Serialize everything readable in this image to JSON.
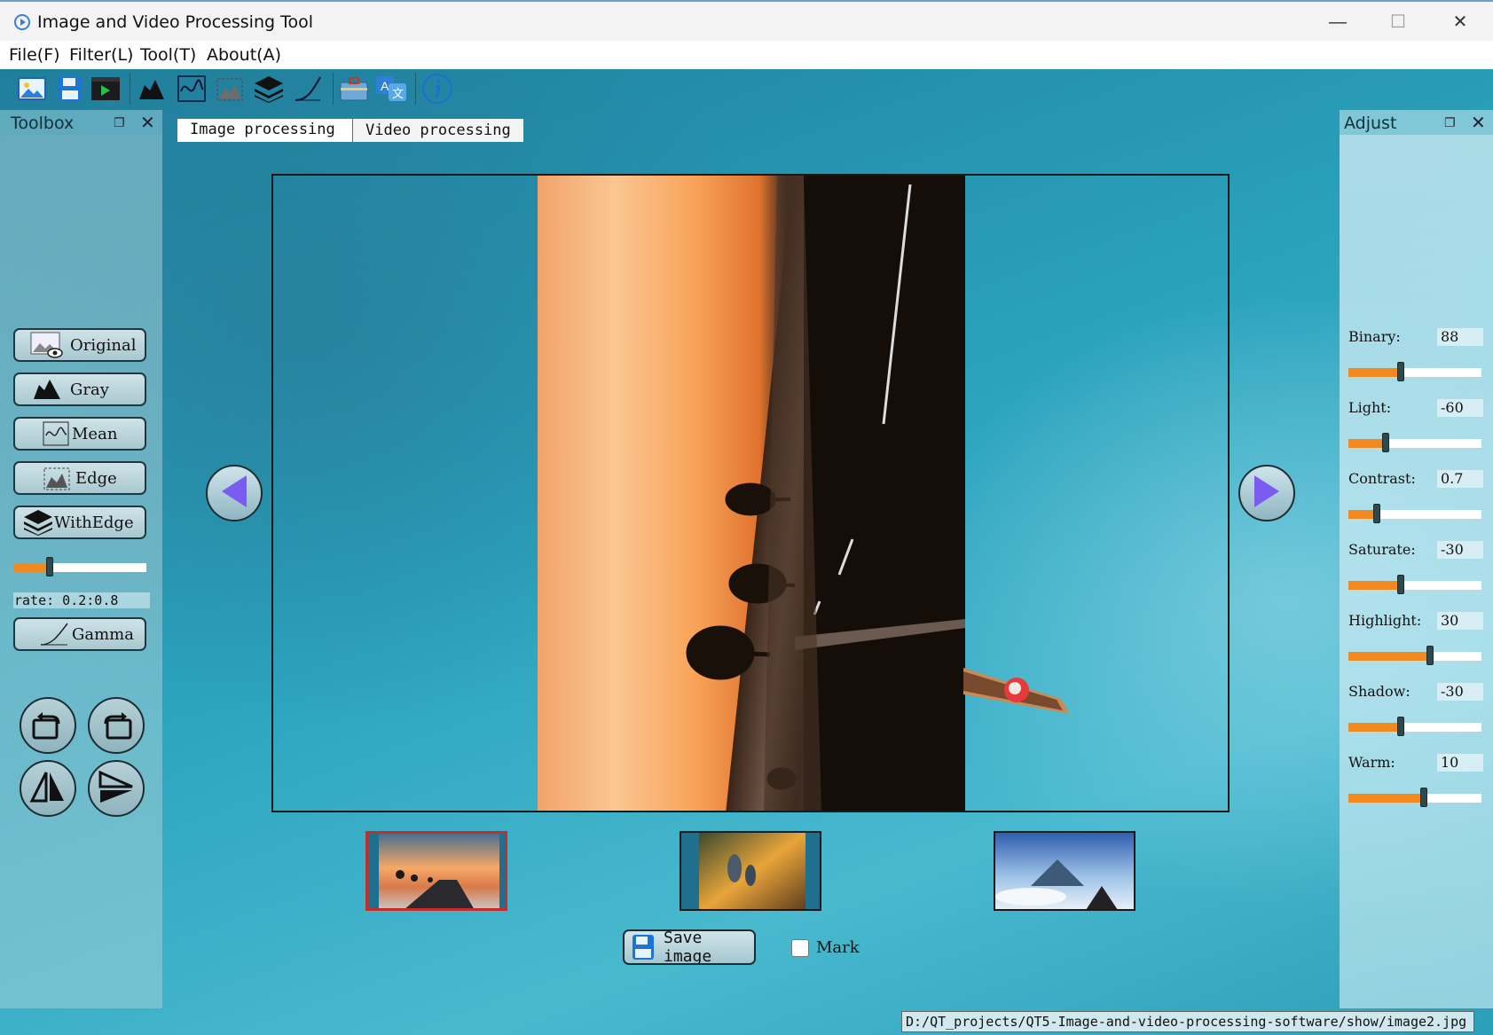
{
  "window": {
    "title": "Image and Video Processing Tool",
    "minimize_glyph": "—",
    "maximize_glyph": "☐",
    "close_glyph": "✕"
  },
  "menu": {
    "file": "File(F)",
    "filter": "Filter(L)",
    "tool": "Tool(T)",
    "about": "About(A)"
  },
  "toolbar": {
    "icons": [
      "open-image-icon",
      "save-icon",
      "video-icon",
      "gray-icon",
      "mean-icon",
      "edge-icon",
      "layers-icon",
      "gamma-icon",
      "toolbox-icon",
      "translate-icon",
      "info-icon"
    ]
  },
  "toolbox": {
    "title": "Toolbox",
    "buttons": {
      "original": "Original",
      "gray": "Gray",
      "mean": "Mean",
      "edge": "Edge",
      "withedge": "WithEdge",
      "gamma": "Gamma"
    },
    "withedge_slider_fraction": 0.27,
    "rate_label": "rate: 0.2:0.8"
  },
  "tabs": {
    "image": "Image processing",
    "video": "Video processing"
  },
  "actions": {
    "save_image": "Save image",
    "mark": "Mark",
    "mark_checked": false
  },
  "adjust": {
    "title": "Adjust",
    "params": {
      "binary": {
        "label": "Binary:",
        "value": "88",
        "fraction": 0.39
      },
      "light": {
        "label": "Light:",
        "value": "-60",
        "fraction": 0.28
      },
      "contrast": {
        "label": "Contrast:",
        "value": "0.7",
        "fraction": 0.21
      },
      "saturate": {
        "label": "Saturate:",
        "value": "-30",
        "fraction": 0.39
      },
      "highlight": {
        "label": "Highlight:",
        "value": "30",
        "fraction": 0.61
      },
      "shadow": {
        "label": "Shadow:",
        "value": "-30",
        "fraction": 0.39
      },
      "warm": {
        "label": "Warm:",
        "value": "10",
        "fraction": 0.57
      }
    }
  },
  "thumbnails": {
    "selected_index": 0,
    "count": 3
  },
  "status": {
    "path": "D:/QT_projects/QT5-Image-and-video-processing-software/show/image2.jpg"
  },
  "colors": {
    "accent_orange": "#f2891e",
    "nav_arrow": "#7a5cf0",
    "selected_thumb_border": "#c92a2a"
  }
}
